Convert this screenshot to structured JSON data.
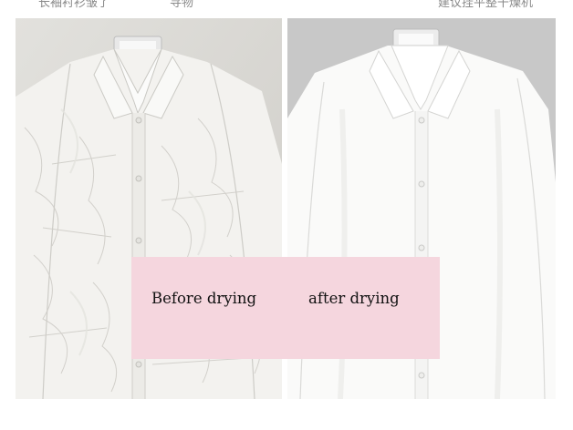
{
  "header_fragments": [
    "长袖衬衫皱了",
    "寻物",
    "建议挂平整干燥机"
  ],
  "captions": {
    "before": "Before drying",
    "after": "after drying"
  },
  "colors": {
    "overlay": "#f5d6de",
    "shirt": "#f7f7f5",
    "wrinkled_background": "#d9d8d4",
    "smooth_background": "#c6c6c6"
  },
  "images": {
    "left": "wrinkled-white-shirt",
    "right": "smooth-white-shirt"
  }
}
